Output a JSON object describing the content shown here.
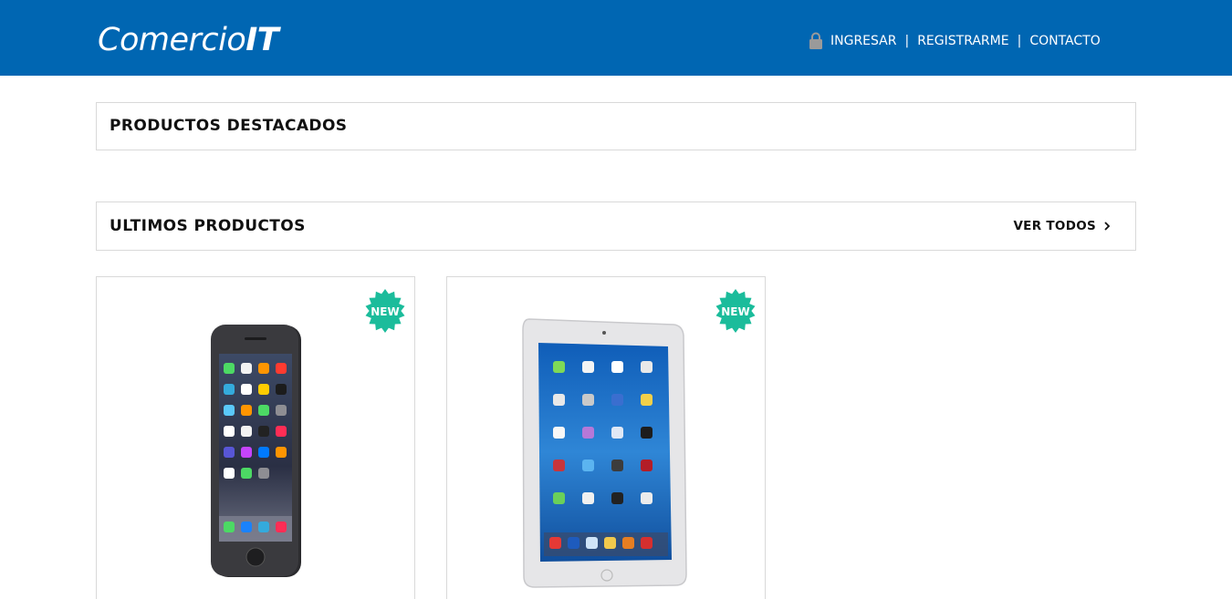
{
  "header": {
    "logo_regular": "Comercio",
    "logo_bold": "IT",
    "nav": [
      {
        "label": "INGRESAR",
        "icon": "lock-icon"
      },
      {
        "label": "REGISTRARME"
      },
      {
        "label": "CONTACTO"
      }
    ],
    "separator": "|"
  },
  "featured": {
    "title": "PRODUCTOS DESTACADOS"
  },
  "latest": {
    "title": "ULTIMOS PRODUCTOS",
    "see_all": "VER TODOS",
    "products": [
      {
        "badge": "NEW",
        "image": "smartphone-image"
      },
      {
        "badge": "NEW",
        "image": "tablet-image"
      }
    ]
  },
  "colors": {
    "brand": "#0066b2",
    "badge": "#1bbc9b",
    "border": "#d9d9d9"
  }
}
